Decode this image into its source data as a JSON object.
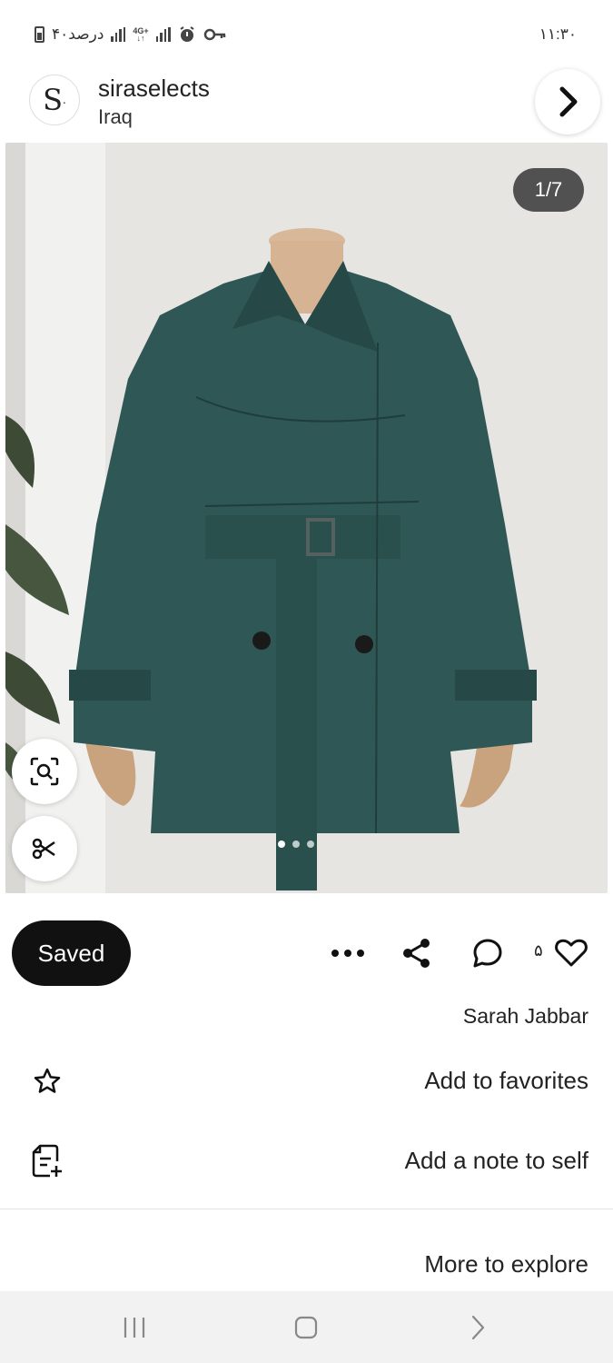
{
  "status_bar": {
    "left_text": "۴۰درصد",
    "network": "4G+",
    "time": "۱۱:۳۰"
  },
  "header": {
    "avatar_letter": "S",
    "account_name": "siraselects",
    "location": "Iraq"
  },
  "pin_image": {
    "counter": "1/7",
    "page_dots": 3,
    "active_dot": 0,
    "description": "Dark teal belted trench coat on mannequin"
  },
  "actions": {
    "saved_label": "Saved",
    "like_count": "۵"
  },
  "pinner_name": "Sarah Jabbar",
  "menu": [
    {
      "icon": "star-icon",
      "label": "Add to favorites"
    },
    {
      "icon": "note-add-icon",
      "label": "Add a note to self"
    }
  ],
  "more_to_explore": "More to explore",
  "colors": {
    "coat": "#2f5755",
    "saved_bg": "#111111",
    "background": "#ffffff",
    "nav_bg": "#f2f2f2"
  }
}
